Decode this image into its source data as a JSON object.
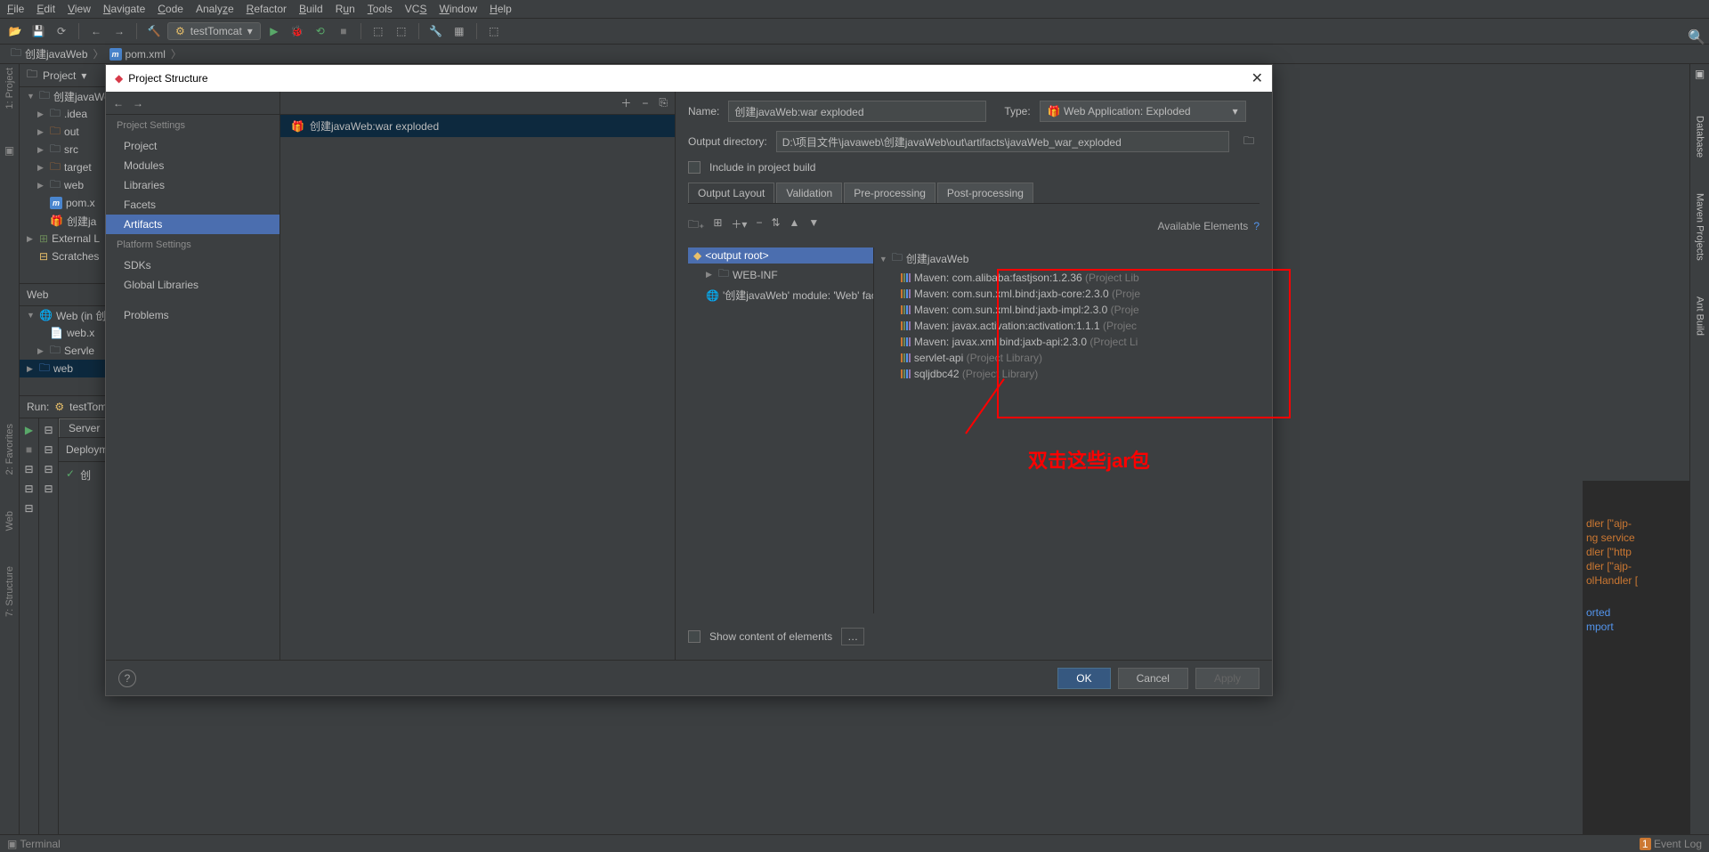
{
  "menu": [
    "File",
    "Edit",
    "View",
    "Navigate",
    "Code",
    "Analyze",
    "Refactor",
    "Build",
    "Run",
    "Tools",
    "VCS",
    "Window",
    "Help"
  ],
  "runConfig": "testTomcat",
  "breadcrumb": {
    "project": "创建javaWeb",
    "file": "pom.xml"
  },
  "projectPanel": {
    "title": "Project",
    "items": [
      {
        "lvl": 0,
        "exp": "▼",
        "icon": "folder",
        "label": "创建javaWeb"
      },
      {
        "lvl": 1,
        "exp": "▶",
        "icon": "folder",
        "label": ".idea"
      },
      {
        "lvl": 1,
        "exp": "▶",
        "icon": "folder-orange",
        "label": "out"
      },
      {
        "lvl": 1,
        "exp": "▶",
        "icon": "folder",
        "label": "src"
      },
      {
        "lvl": 1,
        "exp": "▶",
        "icon": "folder-orange",
        "label": "target"
      },
      {
        "lvl": 1,
        "exp": "▶",
        "icon": "folder",
        "label": "web"
      },
      {
        "lvl": 1,
        "exp": "",
        "icon": "maven",
        "label": "pom.x"
      },
      {
        "lvl": 1,
        "exp": "",
        "icon": "gift",
        "label": "创建ja"
      },
      {
        "lvl": 0,
        "exp": "▶",
        "icon": "lib",
        "label": "External L"
      },
      {
        "lvl": 0,
        "exp": "",
        "icon": "scratch",
        "label": "Scratches"
      }
    ]
  },
  "webPanel": {
    "title": "Web",
    "items": [
      {
        "lvl": 0,
        "exp": "▼",
        "icon": "web",
        "label": "Web (in 创"
      },
      {
        "lvl": 1,
        "exp": "",
        "icon": "xml",
        "label": "web.x"
      },
      {
        "lvl": 1,
        "exp": "▶",
        "icon": "folder",
        "label": "Servle"
      },
      {
        "lvl": 0,
        "exp": "▶",
        "icon": "folder",
        "label": "web"
      }
    ]
  },
  "runPanel": {
    "title": "Run:",
    "config": "testTomcat",
    "tabs": [
      "Server"
    ],
    "tab2": "Deploymen",
    "line": "创"
  },
  "dialog": {
    "title": "Project Structure",
    "sections": {
      "projectSettings": "Project Settings",
      "platformSettings": "Platform Settings"
    },
    "items1": [
      "Project",
      "Modules",
      "Libraries",
      "Facets",
      "Artifacts"
    ],
    "items2": [
      "SDKs",
      "Global Libraries"
    ],
    "items3": [
      "Problems"
    ],
    "selectedItem": "Artifacts",
    "artifact": "创建javaWeb:war exploded",
    "form": {
      "nameLabel": "Name:",
      "nameValue": "创建javaWeb:war exploded",
      "typeLabel": "Type:",
      "typeValue": "Web Application: Exploded",
      "outDirLabel": "Output directory:",
      "outDirValue": "D:\\项目文件\\javaweb\\创建javaWeb\\out\\artifacts\\javaWeb_war_exploded",
      "includeLabel": "Include in project build"
    },
    "layoutTabs": [
      "Output Layout",
      "Validation",
      "Pre-processing",
      "Post-processing"
    ],
    "availElements": "Available Elements",
    "outputTree": [
      {
        "lvl": 0,
        "icon": "root",
        "label": "<output root>",
        "root": true
      },
      {
        "lvl": 1,
        "exp": "▶",
        "icon": "folder",
        "label": "WEB-INF"
      },
      {
        "lvl": 1,
        "icon": "facet",
        "label": "'创建javaWeb' module: 'Web' facet resources"
      }
    ],
    "availTree": {
      "root": "创建javaWeb",
      "libs": [
        {
          "name": "Maven: com.alibaba:fastjson:1.2.36",
          "suffix": " (Project Lib"
        },
        {
          "name": "Maven: com.sun.xml.bind:jaxb-core:2.3.0",
          "suffix": " (Proje"
        },
        {
          "name": "Maven: com.sun.xml.bind:jaxb-impl:2.3.0",
          "suffix": " (Proje"
        },
        {
          "name": "Maven: javax.activation:activation:1.1.1",
          "suffix": " (Projec"
        },
        {
          "name": "Maven: javax.xml.bind:jaxb-api:2.3.0",
          "suffix": " (Project Li"
        },
        {
          "name": "servlet-api",
          "suffix": " (Project Library)"
        },
        {
          "name": "sqljdbc42",
          "suffix": " (Project Library)"
        }
      ]
    },
    "showContent": "Show content of elements",
    "buttons": {
      "ok": "OK",
      "cancel": "Cancel",
      "apply": "Apply"
    }
  },
  "annotation": "双击这些jar包",
  "statusbar": {
    "terminal": "Terminal",
    "eventlog": "Event Log"
  },
  "console": [
    "dler [\"ajp-",
    "ng service",
    "dler [\"http",
    "dler [\"ajp-",
    "olHandler [",
    "orted",
    "mport"
  ],
  "sideTabs": {
    "project": "1: Project",
    "favorites": "2: Favorites",
    "web": "Web",
    "structure": "7: Structure",
    "database": "Database",
    "maven": "Maven Projects",
    "ant": "Ant Build"
  }
}
